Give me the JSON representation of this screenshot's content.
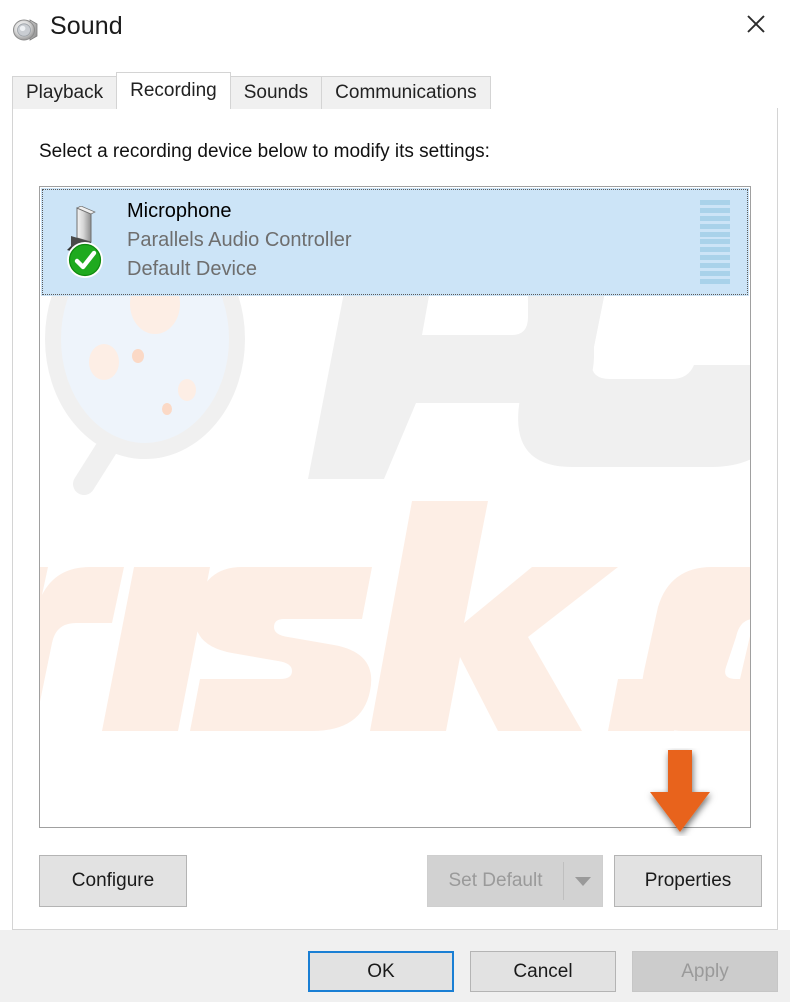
{
  "window": {
    "title": "Sound",
    "icon": "speaker-icon",
    "close_label": "✕"
  },
  "tabs": [
    {
      "label": "Playback",
      "active": false
    },
    {
      "label": "Recording",
      "active": true
    },
    {
      "label": "Sounds",
      "active": false
    },
    {
      "label": "Communications",
      "active": false
    }
  ],
  "panel": {
    "instruction": "Select a recording device below to modify its settings:"
  },
  "device_list": {
    "items": [
      {
        "name": "Microphone",
        "driver": "Parallels Audio Controller",
        "status": "Default Device",
        "icon": "microphone-icon",
        "badge": "default-check-icon",
        "selected": true,
        "meter_segments": 11,
        "meter_color": "#a9d2ea"
      }
    ],
    "selection_color": "#cce4f7"
  },
  "watermark": {
    "text_primary": "PC",
    "text_secondary": "risk.com",
    "gray": "#f0f0f0",
    "peach": "#fdeee5",
    "glass_fill": "#eef4fb"
  },
  "actions": {
    "configure": {
      "label": "Configure",
      "enabled": true
    },
    "set_default": {
      "label": "Set Default",
      "enabled": false,
      "has_dropdown": true
    },
    "properties": {
      "label": "Properties",
      "enabled": true
    }
  },
  "footer": {
    "ok": {
      "label": "OK",
      "enabled": true,
      "is_default": true
    },
    "cancel": {
      "label": "Cancel",
      "enabled": true
    },
    "apply": {
      "label": "Apply",
      "enabled": false
    }
  },
  "annotation": {
    "arrow": "down-arrow-annotation",
    "color": "#e8641e",
    "points_at": "Properties"
  }
}
